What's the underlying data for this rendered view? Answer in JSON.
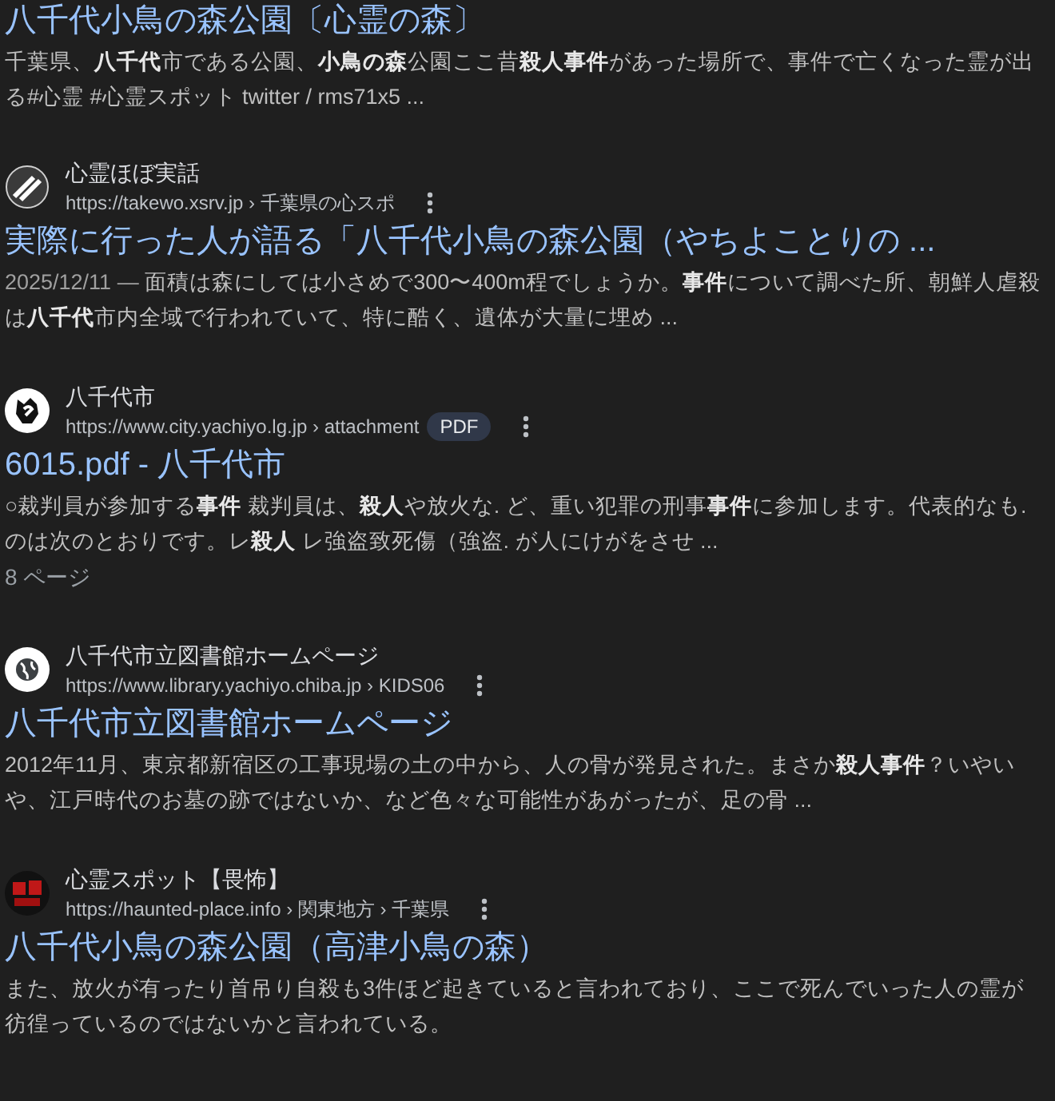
{
  "results": [
    {
      "title": "八千代小鳥の森公園〔心霊の森〕",
      "snippet": "千葉県、**八千代**市である公園、**小鳥の森**公園ここ昔**殺人事件**があった場所で、事件で亡くなった霊が出る#心霊 #心霊スポット twitter / rms71x5 ..."
    },
    {
      "site": {
        "name": "心霊ほぼ実話",
        "url": "https://takewo.xsrv.jp › 千葉県の心スポ",
        "kind": "slash"
      },
      "title": "実際に行った人が語る「八千代小鳥の森公園（やちよことりの ...",
      "date": "2025/12/11 —",
      "snippet": "面積は森にしては小さめで300〜400m程でしょうか。**事件**について調べた所、朝鮮人虐殺は**八千代**市内全域で行われていて、特に酷く、遺体が大量に埋め ..."
    },
    {
      "site": {
        "name": "八千代市",
        "url": "https://www.city.yachiyo.lg.jp › attachment",
        "kind": "emblem"
      },
      "badge": "PDF",
      "title": "6015.pdf - 八千代市",
      "snippet": "○裁判員が参加する**事件** 裁判員は、**殺人**や放火な. ど、重い犯罪の刑事**事件**に参加します。代表的なも. のは次のとおりです。レ**殺人** レ強盗致死傷（強盗. が人にけがをさせ ...",
      "meta": "8 ページ"
    },
    {
      "site": {
        "name": "八千代市立図書館ホームページ",
        "url": "https://www.library.yachiyo.chiba.jp › KIDS06",
        "kind": "globe"
      },
      "title": "八千代市立図書館ホームページ",
      "snippet": "2012年11月、東京都新宿区の工事現場の土の中から、人の骨が発見された。まさか**殺人事件**？いやいや、江戸時代のお墓の跡ではないか、など色々な可能性があがったが、足の骨 ..."
    },
    {
      "site": {
        "name": "心霊スポット【畏怖】",
        "url": "https://haunted-place.info › 関東地方 › 千葉県",
        "kind": "redlogo"
      },
      "title": "八千代小鳥の森公園（高津小鳥の森）",
      "snippet": "また、放火が有ったり首吊り自殺も3件ほど起きていると言われており、ここで死んでいった人の霊が彷徨っているのではないかと言われている。"
    }
  ]
}
